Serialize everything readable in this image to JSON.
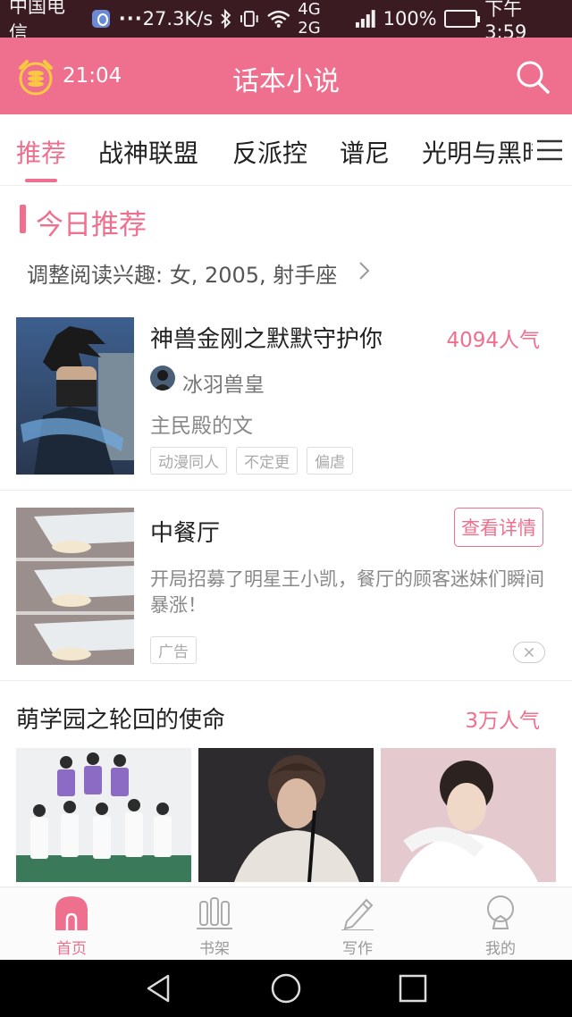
{
  "status_bar": {
    "carrier": "中国电信",
    "dots": "···",
    "speed": "27.3K/s",
    "network": "4G 2G",
    "battery": "100%",
    "time": "下午3:59"
  },
  "header": {
    "timer": "21:04",
    "title": "话本小说"
  },
  "tabs": [
    {
      "label": "推荐"
    },
    {
      "label": "战神联盟"
    },
    {
      "label": "反派控"
    },
    {
      "label": "谱尼"
    },
    {
      "label": "光明与黑暗"
    }
  ],
  "section": {
    "title": "今日推荐",
    "interest": "调整阅读兴趣: 女, 2005, 射手座"
  },
  "book": {
    "title": "神兽金刚之默默守护你",
    "popularity": "4094人气",
    "author": "冰羽兽皇",
    "description": "主民殿的文",
    "tags": [
      "动漫同人",
      "不定更",
      "偏虐"
    ]
  },
  "ad": {
    "title": "中餐厅",
    "button": "查看详情",
    "description": "开局招募了明星王小凯，餐厅的顾客迷妹们瞬间暴涨！",
    "tag": "广告"
  },
  "series": {
    "title": "萌学园之轮回的使命",
    "popularity": "3万人气"
  },
  "bottom_nav": [
    {
      "label": "首页"
    },
    {
      "label": "书架"
    },
    {
      "label": "写作"
    },
    {
      "label": "我的"
    }
  ],
  "colors": {
    "accent": "#ef6f8e",
    "status_bar": "#3a1b22"
  }
}
